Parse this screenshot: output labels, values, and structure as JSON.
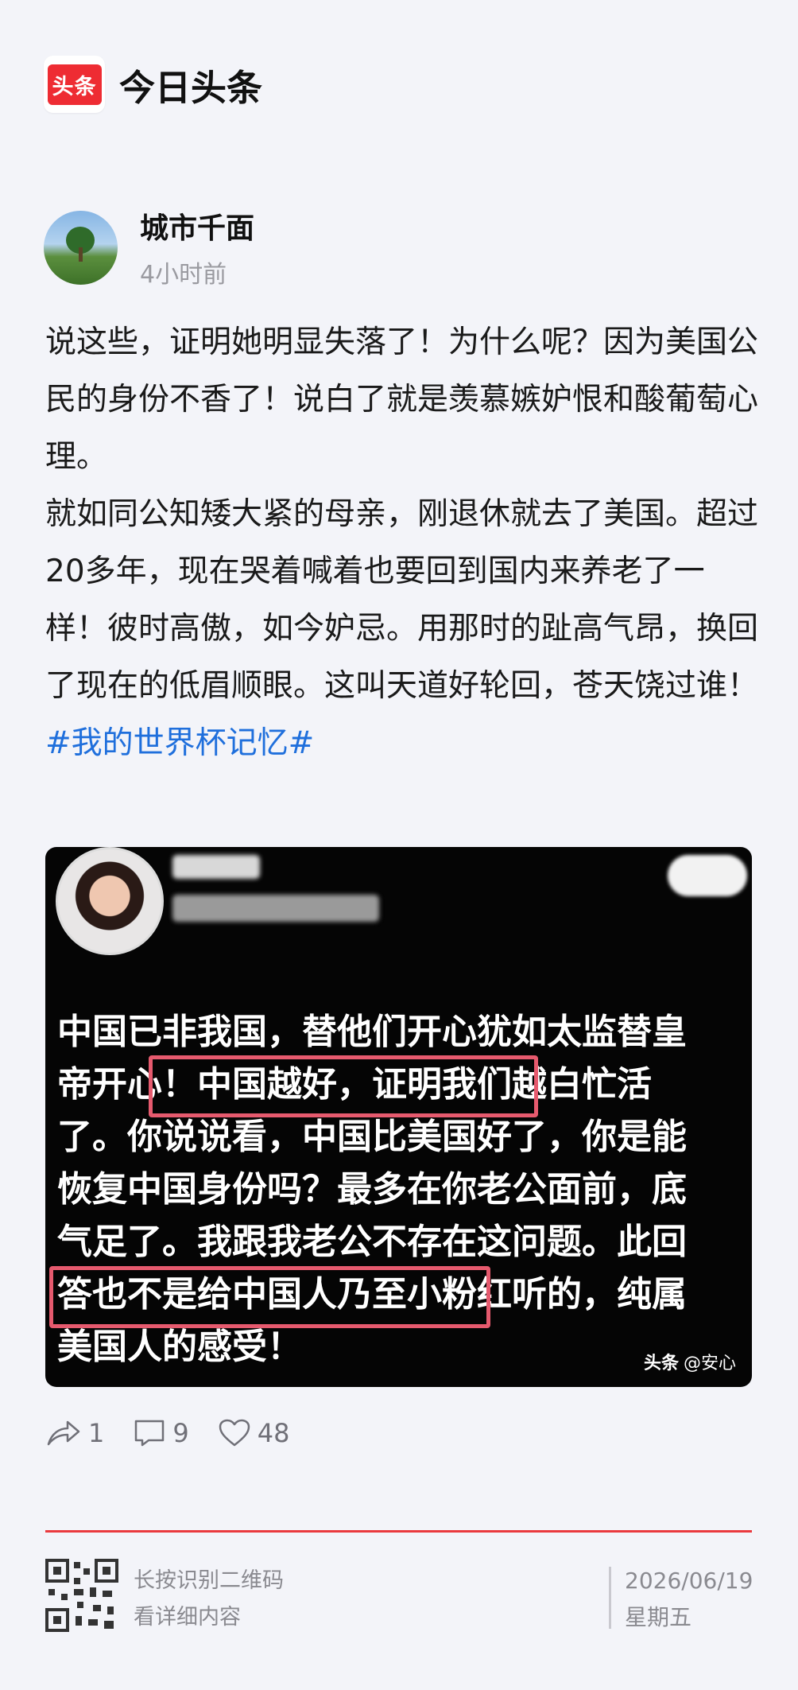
{
  "brand": {
    "logo_text": "头条",
    "name": "今日头条"
  },
  "author": {
    "name": "城市千面",
    "time": "4小时前"
  },
  "post": {
    "paragraphs": [
      "说这些，证明她明显失落了！为什么呢？因为美国公民的身份不香了！说白了就是羡慕嫉妒恨和酸葡萄心理。",
      "就如同公知矮大紧的母亲，刚退休就去了美国。超过20多年，现在哭着喊着也要回到国内来养老了一样！彼时高傲，如今妒忌。用那时的趾高气昂，换回了现在的低眉顺眼。这叫天道好轮回，苍天饶过谁！"
    ],
    "hashtag": "#我的世界杯记忆#"
  },
  "embed": {
    "lines": [
      "中国已非我国，替他们开心犹如太监替皇",
      "帝开心！中国越好，证明我们越白忙活",
      "了。你说说看，中国比美国好了，你是能",
      "恢复中国身份吗？最多在你老公面前，底",
      "气足了。我跟我老公不存在这问题。此回",
      "答也不是给中国人乃至小粉红听的，纯属",
      "美国人的感受！"
    ],
    "watermark_brand": "头条",
    "watermark_user": "@安心"
  },
  "actions": {
    "shares": "1",
    "comments": "9",
    "likes": "48"
  },
  "footer": {
    "qr_line1": "长按识别二维码",
    "qr_line2": "看详细内容",
    "date": "2026/06/19",
    "weekday": "星期五"
  },
  "colors": {
    "accent_red": "#ea3a3e",
    "hashtag_blue": "#1f6fdc",
    "highlight_pink": "#e65a6e"
  }
}
